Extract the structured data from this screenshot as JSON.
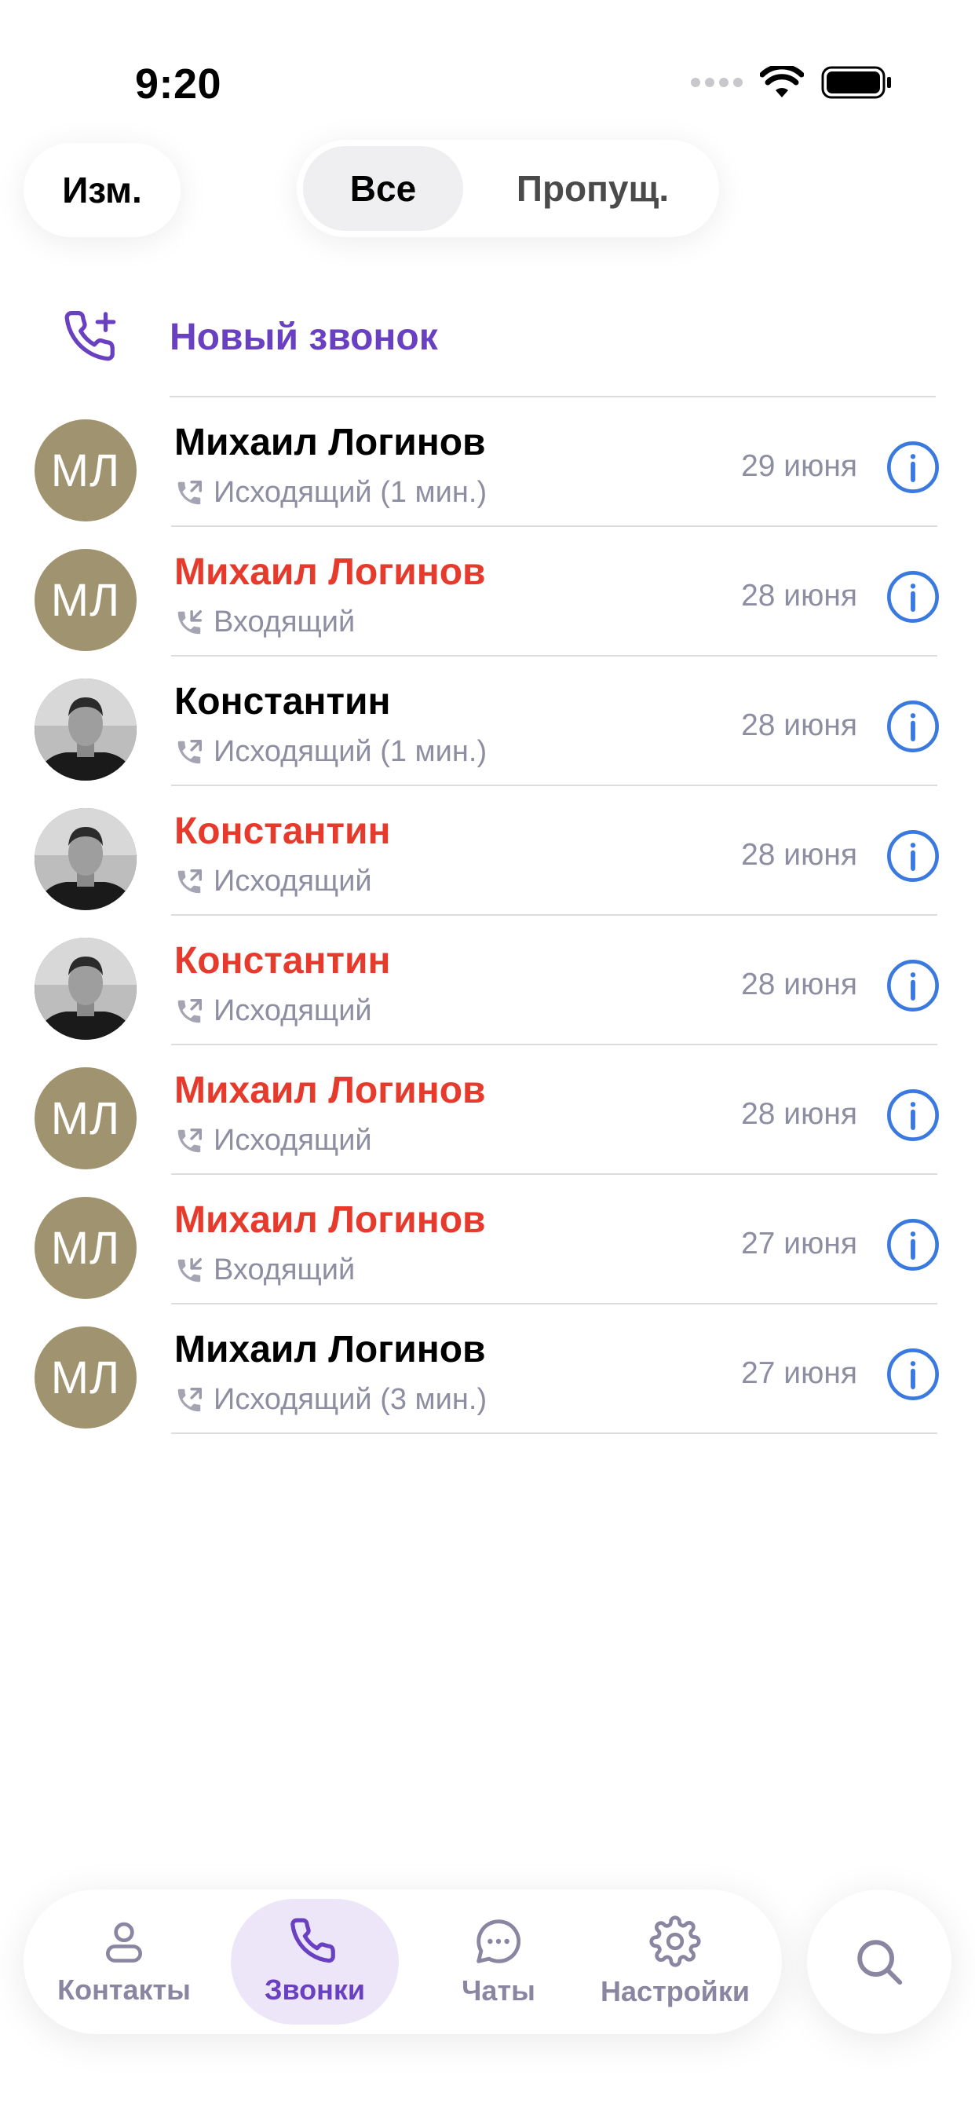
{
  "status_bar": {
    "time": "9:20"
  },
  "header": {
    "edit_label": "Изм.",
    "segments": {
      "all": "Все",
      "missed": "Пропущ."
    }
  },
  "new_call": {
    "label": "Новый звонок"
  },
  "colors": {
    "accent": "#6a40c2",
    "missed": "#e53a2c",
    "info": "#3a7ae0",
    "avatar_bg": "#a0936f",
    "secondary": "#8e8ea3"
  },
  "calls": [
    {
      "name": "Михаил Логинов",
      "avatar": "МЛ",
      "type": "Исходящий (1 мин.)",
      "direction": "outgoing",
      "missed": false,
      "date": "29 июня"
    },
    {
      "name": "Михаил Логинов",
      "avatar": "МЛ",
      "type": "Входящий",
      "direction": "incoming",
      "missed": true,
      "date": "28 июня"
    },
    {
      "name": "Константин",
      "avatar": "photo",
      "type": "Исходящий (1 мин.)",
      "direction": "outgoing",
      "missed": false,
      "date": "28 июня"
    },
    {
      "name": "Константин",
      "avatar": "photo",
      "type": "Исходящий",
      "direction": "outgoing",
      "missed": true,
      "date": "28 июня"
    },
    {
      "name": "Константин",
      "avatar": "photo",
      "type": "Исходящий",
      "direction": "outgoing",
      "missed": true,
      "date": "28 июня"
    },
    {
      "name": "Михаил Логинов",
      "avatar": "МЛ",
      "type": "Исходящий",
      "direction": "outgoing",
      "missed": true,
      "date": "28 июня"
    },
    {
      "name": "Михаил Логинов",
      "avatar": "МЛ",
      "type": "Входящий",
      "direction": "incoming",
      "missed": true,
      "date": "27 июня"
    },
    {
      "name": "Михаил Логинов",
      "avatar": "МЛ",
      "type": "Исходящий (3 мин.)",
      "direction": "outgoing",
      "missed": false,
      "date": "27 июня"
    }
  ],
  "tabbar": {
    "tabs": [
      {
        "label": "Контакты",
        "icon": "person-icon"
      },
      {
        "label": "Звонки",
        "icon": "phone-icon",
        "active": true
      },
      {
        "label": "Чаты",
        "icon": "chat-bubble-icon"
      },
      {
        "label": "Настройки",
        "icon": "gear-icon"
      }
    ],
    "search_icon": "search-icon"
  }
}
